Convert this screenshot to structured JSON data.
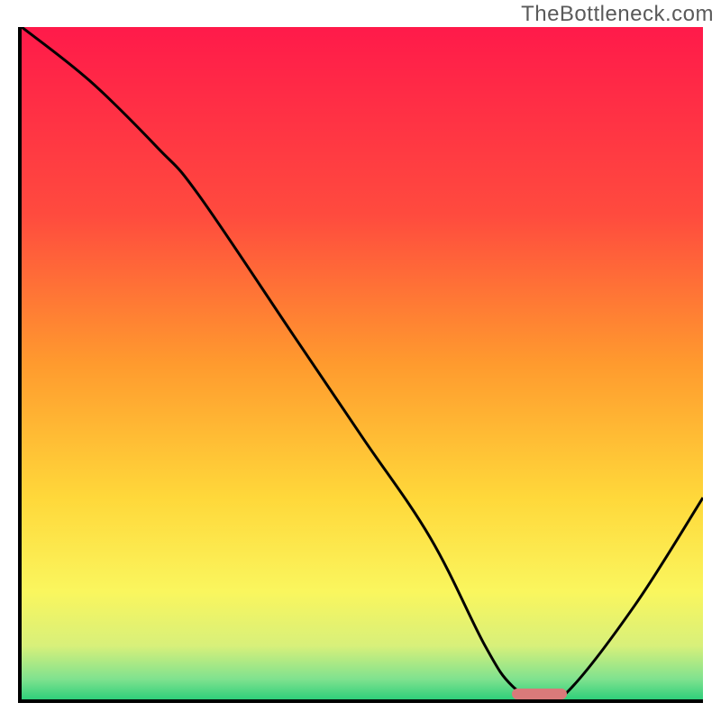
{
  "branding": {
    "watermark": "TheBottleneck.com"
  },
  "chart_data": {
    "type": "line",
    "title": "",
    "xlabel": "",
    "ylabel": "",
    "xlim": [
      0,
      100
    ],
    "ylim": [
      0,
      100
    ],
    "x": [
      0,
      10,
      20,
      26,
      40,
      50,
      60,
      68,
      72,
      76,
      80,
      90,
      100
    ],
    "values": [
      100,
      92,
      82,
      75,
      54,
      39,
      24,
      8,
      2,
      0,
      1,
      14,
      30
    ],
    "annotations": [
      {
        "kind": "min-marker",
        "x_start": 72,
        "x_end": 80,
        "color": "#d97a7a"
      }
    ],
    "gradient_stops": [
      {
        "offset": 0.0,
        "color": "#ff1a4a"
      },
      {
        "offset": 0.28,
        "color": "#ff4b3e"
      },
      {
        "offset": 0.5,
        "color": "#ff9a2e"
      },
      {
        "offset": 0.7,
        "color": "#ffd83a"
      },
      {
        "offset": 0.84,
        "color": "#faf65e"
      },
      {
        "offset": 0.92,
        "color": "#d8f07a"
      },
      {
        "offset": 0.97,
        "color": "#7fe28f"
      },
      {
        "offset": 1.0,
        "color": "#2fcf7a"
      }
    ],
    "curve_color": "#000000",
    "curve_width": 3
  }
}
